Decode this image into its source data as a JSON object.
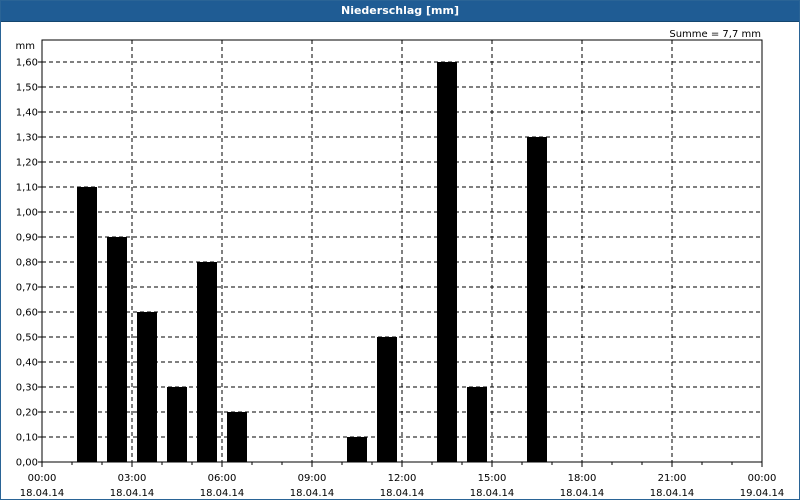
{
  "window": {
    "title": "Niederschlag [mm]"
  },
  "chart_data": {
    "type": "bar",
    "title": "Niederschlag [mm]",
    "ylabel": "mm",
    "summary": "Summe = 7,7 mm",
    "ylim": [
      0,
      1.7
    ],
    "y_ticks": [
      "0,00",
      "0,10",
      "0,20",
      "0,30",
      "0,40",
      "0,50",
      "0,60",
      "0,70",
      "0,80",
      "0,90",
      "1,00",
      "1,10",
      "1,20",
      "1,30",
      "1,40",
      "1,50",
      "1,60"
    ],
    "x_ticks": [
      {
        "time": "00:00",
        "date": "18.04.14"
      },
      {
        "time": "03:00",
        "date": "18.04.14"
      },
      {
        "time": "06:00",
        "date": "18.04.14"
      },
      {
        "time": "09:00",
        "date": "18.04.14"
      },
      {
        "time": "12:00",
        "date": "18.04.14"
      },
      {
        "time": "15:00",
        "date": "18.04.14"
      },
      {
        "time": "18:00",
        "date": "18.04.14"
      },
      {
        "time": "21:00",
        "date": "18.04.14"
      },
      {
        "time": "00:00",
        "date": "19.04.14"
      }
    ],
    "xlim_hours": [
      0,
      24
    ],
    "grid": true,
    "bar_color": "#000000",
    "bars": [
      {
        "hour": 1.5,
        "value": 1.1
      },
      {
        "hour": 2.5,
        "value": 0.9
      },
      {
        "hour": 3.5,
        "value": 0.6
      },
      {
        "hour": 4.5,
        "value": 0.3
      },
      {
        "hour": 5.5,
        "value": 0.8
      },
      {
        "hour": 6.5,
        "value": 0.2
      },
      {
        "hour": 10.5,
        "value": 0.1
      },
      {
        "hour": 11.5,
        "value": 0.5
      },
      {
        "hour": 13.5,
        "value": 1.6
      },
      {
        "hour": 14.5,
        "value": 0.3
      },
      {
        "hour": 16.5,
        "value": 1.3
      }
    ]
  }
}
